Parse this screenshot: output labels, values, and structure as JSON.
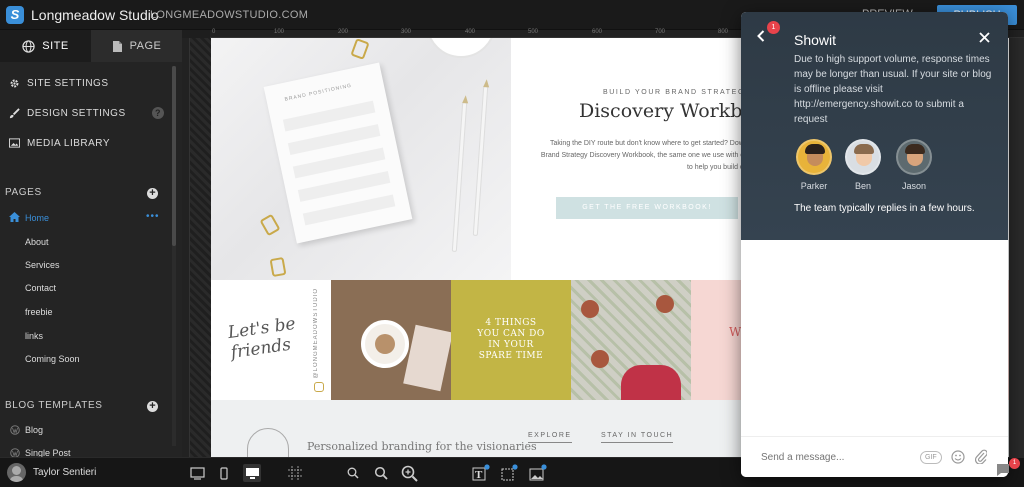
{
  "app": {
    "title": "Longmeadow Studio",
    "domain": "LONGMEADOWSTUDIO.COM",
    "preview_label": "PREVIEW",
    "publish_label": "PUBLISH"
  },
  "sidebar": {
    "tabs": [
      {
        "label": "SITE",
        "icon": "globe-icon",
        "active": true
      },
      {
        "label": "PAGE",
        "icon": "page-icon",
        "active": false
      }
    ],
    "menu": [
      {
        "label": "SITE SETTINGS",
        "icon": "gear-icon"
      },
      {
        "label": "DESIGN SETTINGS",
        "icon": "brush-icon"
      },
      {
        "label": "MEDIA LIBRARY",
        "icon": "image-icon"
      }
    ],
    "help_label": "?",
    "pages_header": "PAGES",
    "pages": [
      "Home",
      "About",
      "Services",
      "Contact",
      "freebie",
      "links",
      "Coming Soon"
    ],
    "current_page": "Home",
    "page_options": "•••",
    "blog_header": "BLOG TEMPLATES",
    "blog_templates": [
      "Blog",
      "Single Post"
    ]
  },
  "user": {
    "name": "Taylor Sentieri"
  },
  "ruler": [
    "0",
    "100",
    "200",
    "300",
    "400",
    "500",
    "600",
    "700",
    "800",
    "900",
    "1000",
    "1100",
    "1200"
  ],
  "canvas": {
    "hero": {
      "eyebrow": "BUILD YOUR BRAND STRATEGY",
      "headline": "Discovery Workbook",
      "body": "Taking the DIY route but don't know where to get started? Download our free Brand Strategy Discovery Workbook, the same one we use with our own clients to help you build out your brand!",
      "cta": "GET THE FREE WORKBOOK!",
      "paper_title": "BRAND POSITIONING"
    },
    "strip": {
      "script": "Let's be friends",
      "handle": "@LONGMEADOWSTUDIO",
      "olive_text": "4 THINGS YOU CAN DO IN YOUR SPARE TIME",
      "pink_text": "W"
    },
    "footer": {
      "tagline": "Personalized branding for the visionaries",
      "links": [
        "EXPLORE",
        "STAY IN TOUCH"
      ]
    }
  },
  "chat": {
    "title": "Showit",
    "badge": "1",
    "notice": "Due to high support volume, response times may be longer than usual. If your site or blog is offline please visit http://emergency.showit.co to submit a request",
    "agents": [
      {
        "name": "Parker",
        "bg": "#e8b33a",
        "skin": "#c58c5c",
        "hair": "#2a211c"
      },
      {
        "name": "Ben",
        "bg": "#d9dee3",
        "skin": "#f0c9a8",
        "hair": "#8a6b4e"
      },
      {
        "name": "Jason",
        "bg": "#5d6a6f",
        "skin": "#d8a47c",
        "hair": "#3b2a1e"
      }
    ],
    "reply_note": "The team typically replies in a few hours.",
    "input_placeholder": "Send a message...",
    "gif_label": "GIF",
    "launcher_badge": "1"
  },
  "colors": {
    "accent": "#3a8fd9",
    "cta": "#cfe1e2",
    "olive": "#c2b545",
    "chat_header": "#2e3a45",
    "badge": "#e8434b"
  }
}
